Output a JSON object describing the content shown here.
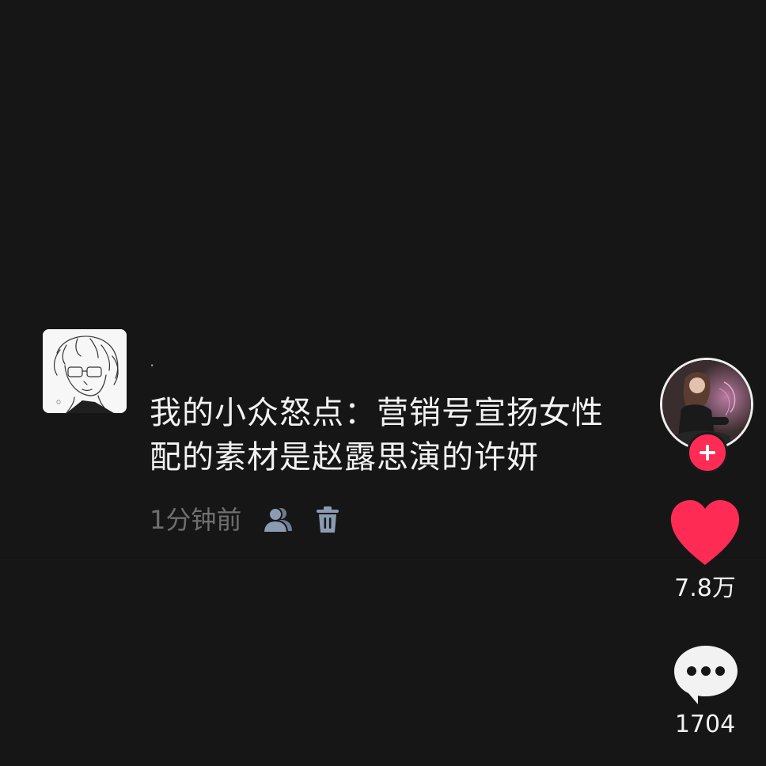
{
  "comment": {
    "username": "·",
    "lines": [
      "我的小众怒点：营销号宣扬女性",
      "配的素材是赵露思演的许妍"
    ],
    "timestamp": "1分钟前",
    "icons": [
      "anime-avatar",
      "visibility-friends-icon",
      "trash-icon"
    ]
  },
  "sidebar": {
    "follow_icon": "plus-icon",
    "like": {
      "icon": "heart-icon",
      "count": "7.8万",
      "color": "#fe2c55"
    },
    "comments": {
      "icon": "chat-bubble-icon",
      "count": "1704"
    }
  },
  "colors": {
    "background": "#161616",
    "accent": "#fe2c55",
    "muted_icon": "#8b9bb1"
  }
}
